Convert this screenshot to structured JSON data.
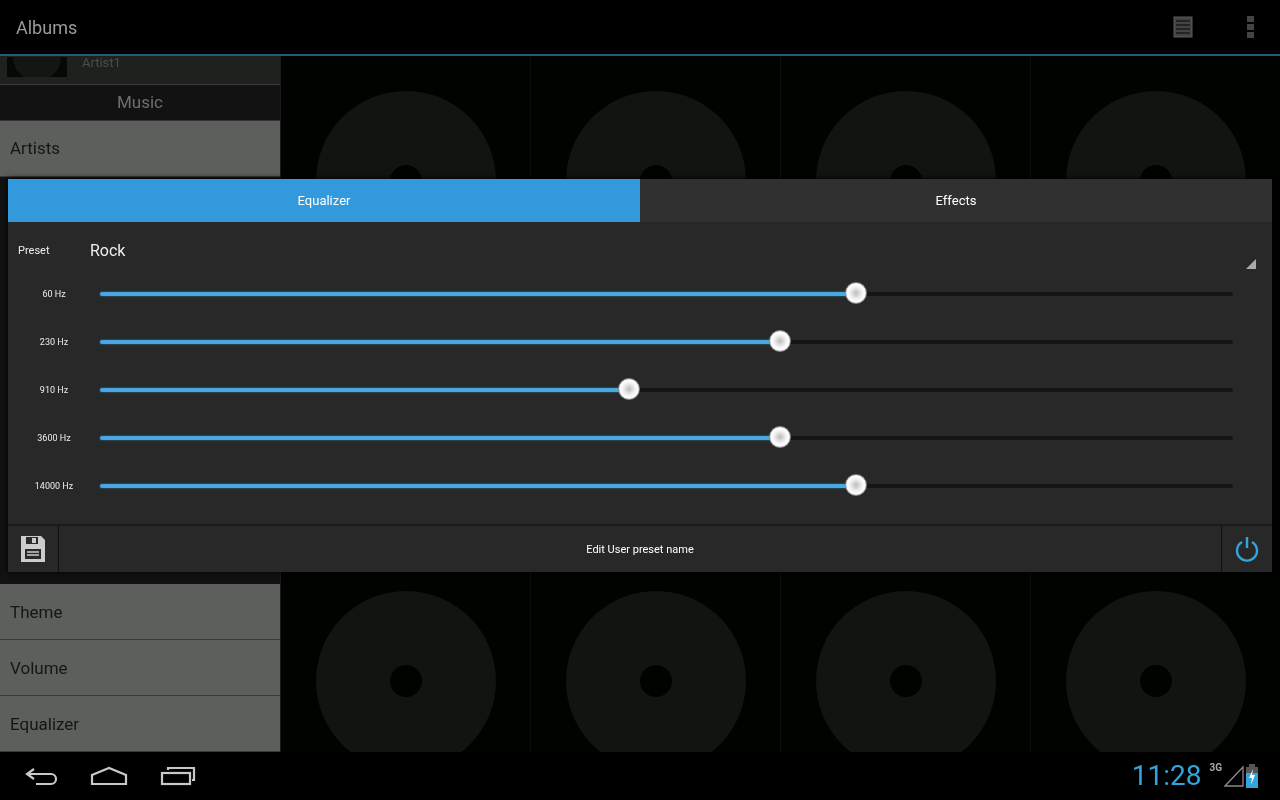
{
  "action_bar": {
    "title": "Albums"
  },
  "sidebar": {
    "artist_row": {
      "artist": "Artist1"
    },
    "music_header": "Music",
    "top_items": [
      "Artists"
    ],
    "bottom_items": [
      "Theme",
      "Volume",
      "Equalizer"
    ]
  },
  "equalizer_dialog": {
    "tabs": [
      {
        "label": "Equalizer",
        "selected": true
      },
      {
        "label": "Effects",
        "selected": false
      }
    ],
    "preset": {
      "label": "Preset",
      "value": "Rock"
    },
    "bands": [
      {
        "label": "60 Hz",
        "level": 0.667
      },
      {
        "label": "230 Hz",
        "level": 0.6
      },
      {
        "label": "910 Hz",
        "level": 0.467
      },
      {
        "label": "3600 Hz",
        "level": 0.6
      },
      {
        "label": "14000 Hz",
        "level": 0.667
      }
    ],
    "footer": {
      "button": "Edit User preset name",
      "power_on": true
    }
  },
  "status_bar": {
    "time": "11:28",
    "network": "3G"
  }
}
